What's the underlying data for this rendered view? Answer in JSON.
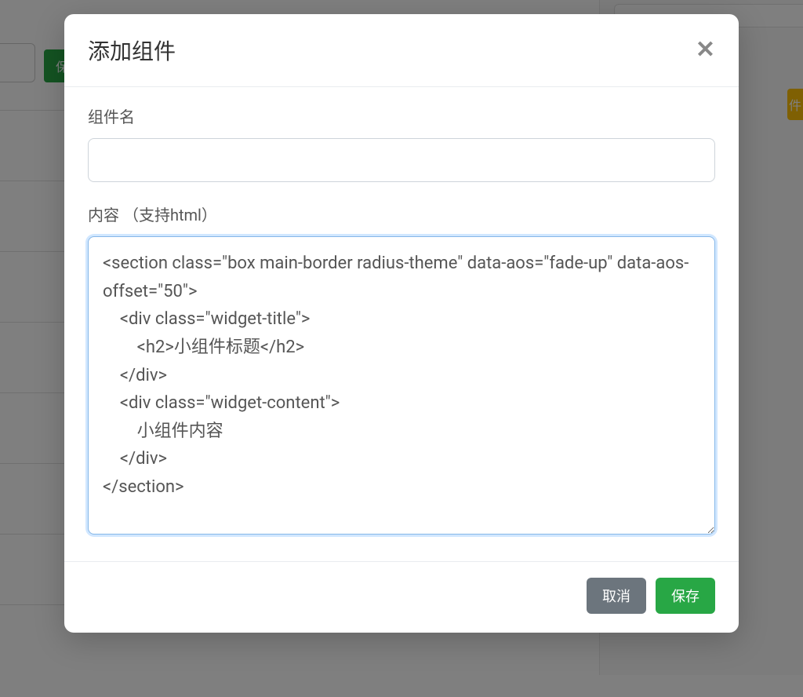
{
  "background": {
    "save_button": "保存",
    "badge_partial": "件"
  },
  "modal": {
    "title": "添加组件",
    "fields": {
      "name": {
        "label": "组件名",
        "value": ""
      },
      "content": {
        "label": "内容 （支持html）",
        "value": "<section class=\"box main-border radius-theme\" data-aos=\"fade-up\" data-aos-offset=\"50\">\n    <div class=\"widget-title\">\n        <h2>小组件标题</h2>\n    </div>\n    <div class=\"widget-content\">\n        小组件内容\n    </div>\n</section>"
      }
    },
    "buttons": {
      "cancel": "取消",
      "save": "保存"
    }
  }
}
